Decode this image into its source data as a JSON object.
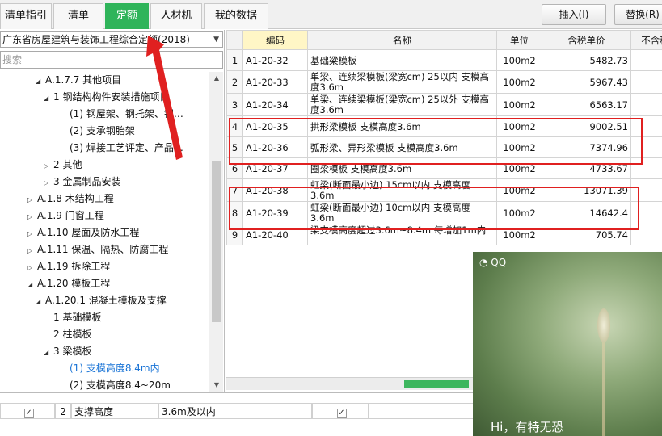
{
  "tabs": [
    {
      "label": "清单指引",
      "active": false
    },
    {
      "label": "清单",
      "active": false
    },
    {
      "label": "定额",
      "active": true
    },
    {
      "label": "人材机",
      "active": false
    },
    {
      "label": "我的数据",
      "active": false
    }
  ],
  "toolbar": {
    "insert_label": "插入(I)",
    "replace_label": "替换(R)"
  },
  "library": {
    "selected": "广东省房屋建筑与装饰工程综合定额(2018)"
  },
  "search": {
    "placeholder": "搜索"
  },
  "tree": [
    {
      "label": "A.1.7.7 其他项目",
      "indent": 2,
      "toggle": "expanded"
    },
    {
      "label": "1 钢结构构件安装措施项目",
      "indent": 3,
      "toggle": "expanded"
    },
    {
      "label": "(1) 钢屋架、钢托架、钢…",
      "indent": 5,
      "toggle": "none"
    },
    {
      "label": "(2) 支承钢胎架",
      "indent": 5,
      "toggle": "none"
    },
    {
      "label": "(3) 焊接工艺评定、产品…",
      "indent": 5,
      "toggle": "none"
    },
    {
      "label": "2 其他",
      "indent": 3,
      "toggle": "collapsed"
    },
    {
      "label": "3 金属制品安装",
      "indent": 3,
      "toggle": "collapsed"
    },
    {
      "label": "A.1.8 木结构工程",
      "indent": 1,
      "toggle": "collapsed"
    },
    {
      "label": "A.1.9 门窗工程",
      "indent": 1,
      "toggle": "collapsed"
    },
    {
      "label": "A.1.10 屋面及防水工程",
      "indent": 1,
      "toggle": "collapsed"
    },
    {
      "label": "A.1.11 保温、隔热、防腐工程",
      "indent": 1,
      "toggle": "collapsed"
    },
    {
      "label": "A.1.19 拆除工程",
      "indent": 1,
      "toggle": "collapsed"
    },
    {
      "label": "A.1.20 模板工程",
      "indent": 1,
      "toggle": "expanded"
    },
    {
      "label": "A.1.20.1 混凝土模板及支撑",
      "indent": 2,
      "toggle": "expanded"
    },
    {
      "label": "1 基础模板",
      "indent": 3,
      "toggle": "none"
    },
    {
      "label": "2 柱模板",
      "indent": 3,
      "toggle": "none"
    },
    {
      "label": "3 梁模板",
      "indent": 3,
      "toggle": "expanded"
    },
    {
      "label": "(1) 支模高度8.4m内",
      "indent": 5,
      "toggle": "none",
      "selected": true
    },
    {
      "label": "(2) 支模高度8.4~20m",
      "indent": 5,
      "toggle": "none"
    }
  ],
  "grid": {
    "headers": {
      "code": "编码",
      "name": "名称",
      "unit": "单位",
      "price": "含税单价",
      "notax": "不含税"
    },
    "rows": [
      {
        "idx": "1",
        "code": "A1-20-32",
        "name": "基础梁模板",
        "unit": "100m2",
        "price": "5482.73",
        "notax": "5"
      },
      {
        "idx": "2",
        "code": "A1-20-33",
        "name": "单梁、连续梁模板(梁宽cm) 25以内 支模高度3.6m",
        "unit": "100m2",
        "price": "5967.43",
        "notax": "5"
      },
      {
        "idx": "3",
        "code": "A1-20-34",
        "name": "单梁、连续梁模板(梁宽cm) 25以外 支模高度3.6m",
        "unit": "100m2",
        "price": "6563.17",
        "notax": ""
      },
      {
        "idx": "4",
        "code": "A1-20-35",
        "name": "拱形梁模板 支模高度3.6m",
        "unit": "100m2",
        "price": "9002.51",
        "notax": "8"
      },
      {
        "idx": "5",
        "code": "A1-20-36",
        "name": "弧形梁、异形梁模板 支模高度3.6m",
        "unit": "100m2",
        "price": "7374.96",
        "notax": "7"
      },
      {
        "idx": "6",
        "code": "A1-20-37",
        "name": "圈梁模板 支模高度3.6m",
        "unit": "100m2",
        "price": "4733.67",
        "notax": "4"
      },
      {
        "idx": "7",
        "code": "A1-20-38",
        "name": "虹梁(断面最小边) 15cm以内 支模高度3.6m",
        "unit": "100m2",
        "price": "13071.39",
        "notax": "1"
      },
      {
        "idx": "8",
        "code": "A1-20-39",
        "name": "虹梁(断面最小边) 10cm以内 支模高度3.6m",
        "unit": "100m2",
        "price": "14642.4",
        "notax": "13"
      },
      {
        "idx": "9",
        "code": "A1-20-40",
        "name": "梁支模高度超过3.6m~8.4m 每增加1m内",
        "unit": "100m2",
        "price": "705.74",
        "notax": ""
      }
    ]
  },
  "bottom": {
    "partial_label": "",
    "row_idx": "2",
    "row_name": "支撑高度",
    "row_value": "3.6m及以内"
  },
  "qq": {
    "logo": "QQ",
    "message": "Hi，有特无恐"
  }
}
